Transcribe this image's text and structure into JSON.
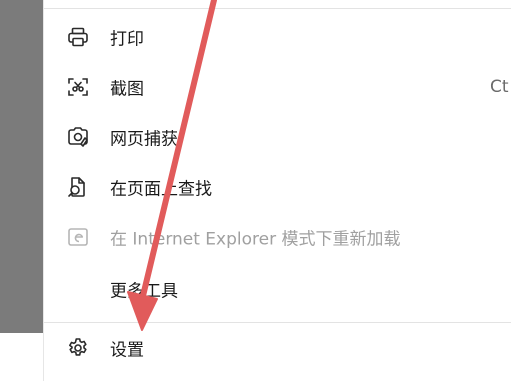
{
  "menu": {
    "items": [
      {
        "label": "打印",
        "icon": "printer-icon"
      },
      {
        "label": "截图",
        "icon": "screenshot-icon",
        "shortcut": "Ct"
      },
      {
        "label": "网页捕获",
        "icon": "web-capture-icon"
      },
      {
        "label": "在页面上查找",
        "icon": "find-in-page-icon"
      },
      {
        "label": "在 Internet Explorer 模式下重新加载",
        "icon": "ie-mode-icon",
        "disabled": true
      },
      {
        "label": "更多工具",
        "icon": ""
      },
      {
        "label": "设置",
        "icon": "gear-icon"
      }
    ]
  },
  "annotation": {
    "arrow_color": "#e15b5b"
  },
  "colors": {
    "left_panel": "#7b7b7b",
    "menu_background": "#ffffff",
    "disabled_text": "#a0a0a0",
    "text": "#1a1a1a"
  }
}
